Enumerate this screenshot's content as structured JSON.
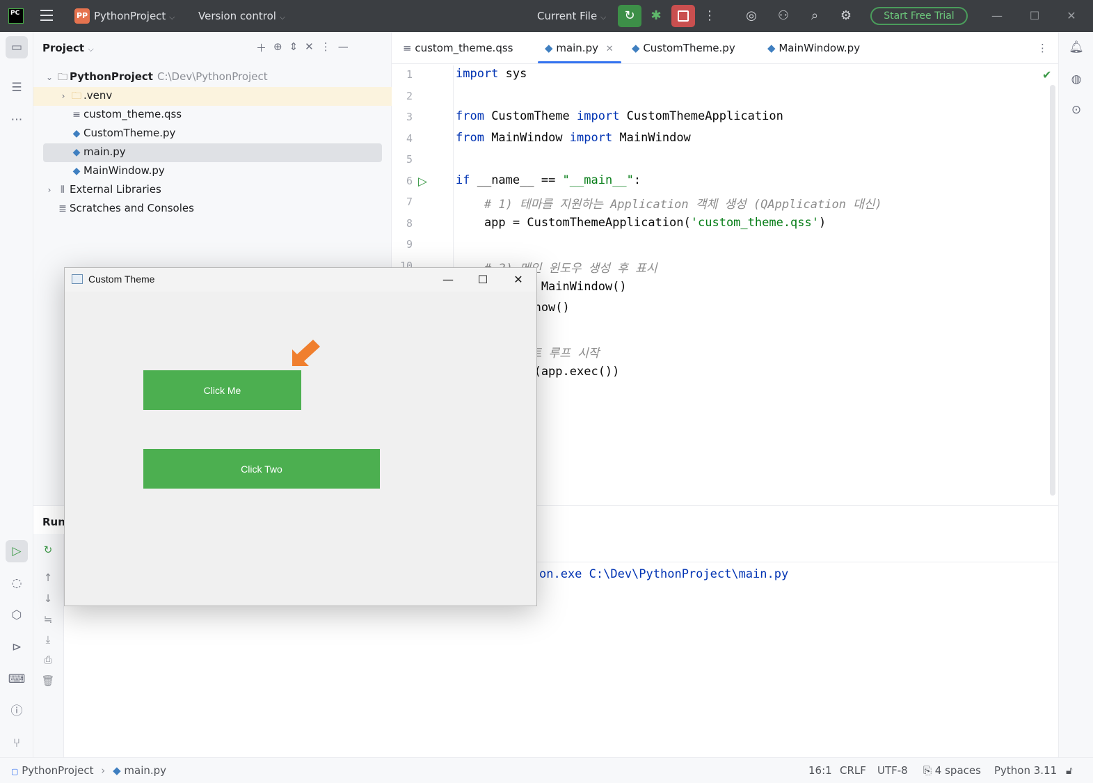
{
  "titlebar": {
    "logo": "PC",
    "project_badge": "PP",
    "project_name": "PythonProject",
    "version_control": "Version control",
    "run_config": "Current File",
    "trial_button": "Start Free Trial"
  },
  "project_panel": {
    "title": "Project",
    "tree": [
      {
        "label": "PythonProject",
        "path": "C:\\Dev\\PythonProject"
      },
      {
        "label": ".venv"
      },
      {
        "label": "custom_theme.qss"
      },
      {
        "label": "CustomTheme.py"
      },
      {
        "label": "main.py"
      },
      {
        "label": "MainWindow.py"
      },
      {
        "label": "External Libraries"
      },
      {
        "label": "Scratches and Consoles"
      }
    ]
  },
  "editor": {
    "tabs": [
      {
        "label": "custom_theme.qss"
      },
      {
        "label": "main.py"
      },
      {
        "label": "CustomTheme.py"
      },
      {
        "label": "MainWindow.py"
      }
    ],
    "line_numbers": [
      "1",
      "2",
      "3",
      "4",
      "5",
      "6",
      "7",
      "8",
      "9",
      "10"
    ],
    "code": {
      "l1_kw": "import",
      "l1_rest": " sys",
      "l3_kw1": "from",
      "l3_mid": " CustomTheme ",
      "l3_kw2": "import",
      "l3_rest": " CustomThemeApplication",
      "l4_kw1": "from",
      "l4_mid": " MainWindow ",
      "l4_kw2": "import",
      "l4_rest": " MainWindow",
      "l6_kw": "if",
      "l6_mid": " __name__ == ",
      "l6_str": "\"__main__\"",
      "l6_end": ":",
      "l7_cm": "    # 1) 테마를 지원하는 Application 객체 생성 (QApplication 대신)",
      "l8_pre": "    app = CustomThemeApplication(",
      "l8_str": "'custom_theme.qss'",
      "l8_end": ")",
      "l10_cm": "    # 2) 메인 윈도우 생성 후 표시",
      "l11": "          = MainWindow()",
      "l12": "         .show()",
      "l14_cm": "         벤트 루프 시작",
      "l15": "         it(app.exec())"
    }
  },
  "run_panel": {
    "title": "Run",
    "console_line": "on.exe C:\\Dev\\PythonProject\\main.py"
  },
  "status_bar": {
    "breadcrumb_project": "PythonProject",
    "breadcrumb_file": "main.py",
    "position": "16:1",
    "line_sep": "CRLF",
    "encoding": "UTF-8",
    "indent": "4 spaces",
    "interpreter": "Python 3.11"
  },
  "qt_window": {
    "title": "Custom Theme",
    "button1": "Click Me",
    "button2": "Click Two",
    "button_color": "#4caf50",
    "annotation_arrow_color": "#f07f2e"
  }
}
